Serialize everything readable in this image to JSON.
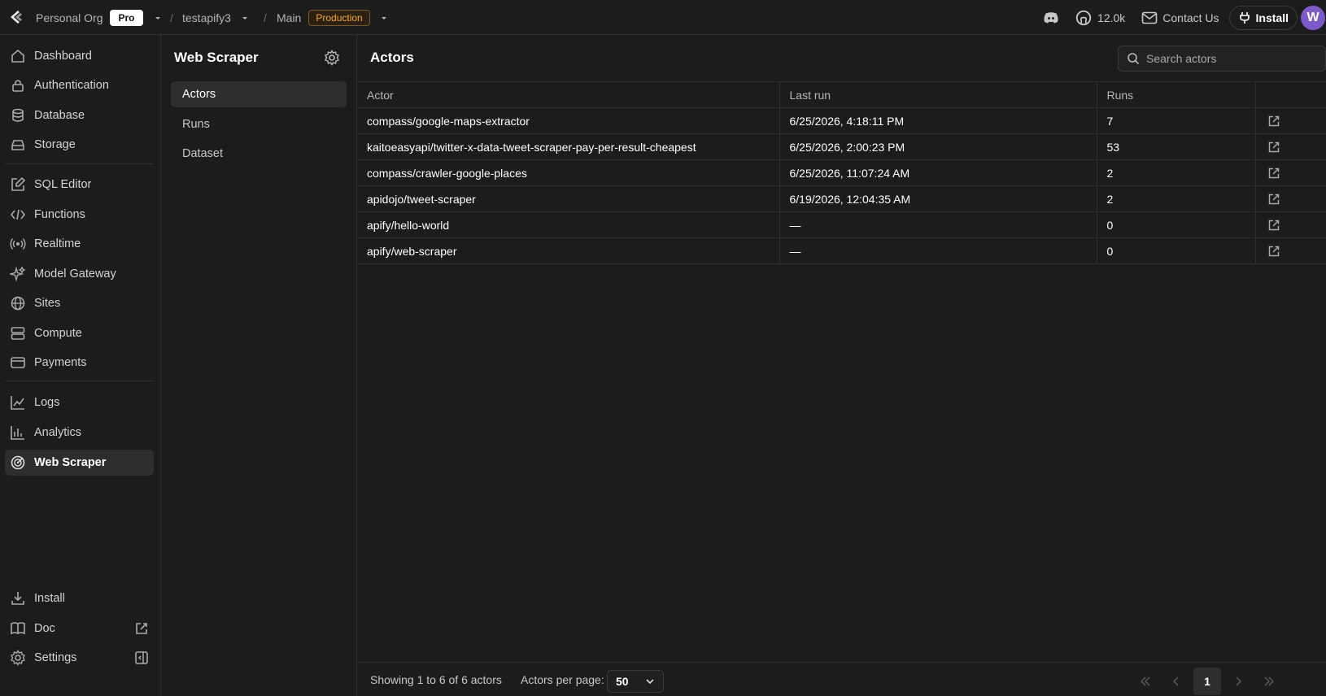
{
  "topbar": {
    "org": "Personal Org",
    "plan": "Pro",
    "project": "testapify3",
    "branch": "Main",
    "environment": "Production",
    "github_stars": "12.0k",
    "contact": "Contact Us",
    "install": "Install",
    "avatar_initial": "W"
  },
  "sidebar": {
    "items": [
      {
        "label": "Dashboard",
        "icon": "home-icon"
      },
      {
        "label": "Authentication",
        "icon": "lock-icon"
      },
      {
        "label": "Database",
        "icon": "database-icon"
      },
      {
        "label": "Storage",
        "icon": "storage-icon"
      },
      {
        "label": "SQL Editor",
        "icon": "edit-icon"
      },
      {
        "label": "Functions",
        "icon": "code-icon"
      },
      {
        "label": "Realtime",
        "icon": "radio-icon"
      },
      {
        "label": "Model Gateway",
        "icon": "sparkles-icon"
      },
      {
        "label": "Sites",
        "icon": "globe-icon"
      },
      {
        "label": "Compute",
        "icon": "server-icon"
      },
      {
        "label": "Payments",
        "icon": "card-icon"
      },
      {
        "label": "Logs",
        "icon": "chart-line-icon"
      },
      {
        "label": "Analytics",
        "icon": "bar-chart-icon"
      },
      {
        "label": "Web Scraper",
        "icon": "radar-icon"
      }
    ],
    "bottom": [
      {
        "label": "Install",
        "icon": "download-icon"
      },
      {
        "label": "Doc",
        "icon": "book-icon"
      },
      {
        "label": "Settings",
        "icon": "gear-icon"
      }
    ],
    "active": "Web Scraper"
  },
  "subpanel": {
    "title": "Web Scraper",
    "items": [
      "Actors",
      "Runs",
      "Dataset"
    ],
    "active": "Actors"
  },
  "main": {
    "title": "Actors",
    "search_placeholder": "Search actors",
    "columns": [
      "Actor",
      "Last run",
      "Runs",
      ""
    ],
    "rows": [
      {
        "actor": "compass/google-maps-extractor",
        "last_run": "6/25/2026, 4:18:11 PM",
        "runs": "7"
      },
      {
        "actor": "kaitoeasyapi/twitter-x-data-tweet-scraper-pay-per-result-cheapest",
        "last_run": "6/25/2026, 2:00:23 PM",
        "runs": "53"
      },
      {
        "actor": "compass/crawler-google-places",
        "last_run": "6/25/2026, 11:07:24 AM",
        "runs": "2"
      },
      {
        "actor": "apidojo/tweet-scraper",
        "last_run": "6/19/2026, 12:04:35 AM",
        "runs": "2"
      },
      {
        "actor": "apify/hello-world",
        "last_run": "—",
        "runs": "0"
      },
      {
        "actor": "apify/web-scraper",
        "last_run": "—",
        "runs": "0"
      }
    ],
    "footer": {
      "showing": "Showing 1 to 6 of 6 actors",
      "per_page_label": "Actors per page:",
      "per_page_value": "50",
      "current_page": "1"
    }
  }
}
